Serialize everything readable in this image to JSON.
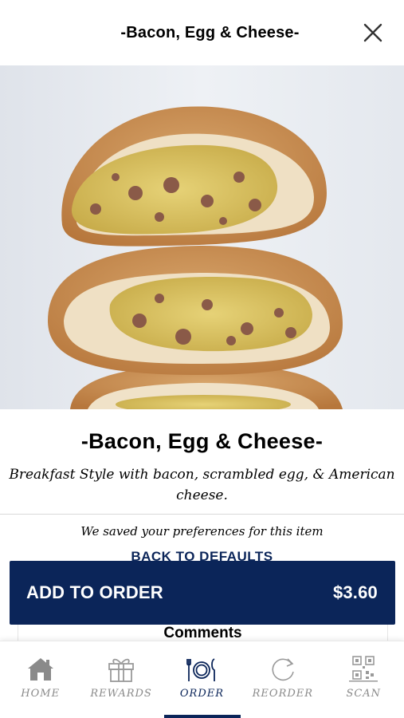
{
  "header": {
    "title": "-Bacon, Egg & Cheese-",
    "close_icon": "close-icon"
  },
  "item": {
    "title": "-Bacon, Egg & Cheese-",
    "description": "Breakfast Style with bacon, scrambled egg, & American cheese.",
    "saved_note": "We saved your preferences for this item",
    "back_to_defaults": "BACK TO DEFAULTS"
  },
  "order_button": {
    "label": "ADD TO ORDER",
    "price": "$3.60"
  },
  "comments": {
    "label": "Comments"
  },
  "tabs": [
    {
      "label": "HOME",
      "icon": "home-icon",
      "active": false
    },
    {
      "label": "REWARDS",
      "icon": "gift-icon",
      "active": false
    },
    {
      "label": "ORDER",
      "icon": "plate-cutlery-icon",
      "active": true
    },
    {
      "label": "REORDER",
      "icon": "refresh-icon",
      "active": false
    },
    {
      "label": "SCAN",
      "icon": "qr-code-icon",
      "active": false
    }
  ],
  "colors": {
    "brand_navy": "#0b2559",
    "inactive_gray": "#8a8a8a"
  }
}
